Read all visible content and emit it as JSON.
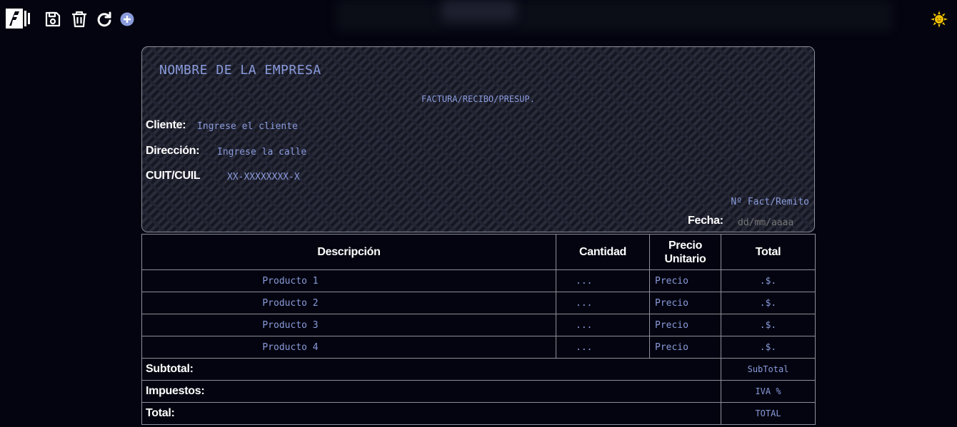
{
  "toolbar": {
    "icons": [
      "brand-logo-icon",
      "save-icon",
      "trash-icon",
      "refresh-icon",
      "add-icon",
      "theme-toggle-sun-icon"
    ],
    "accent": "#8a9bdc",
    "sun_color": "#f2c200"
  },
  "header": {
    "company_name": "NOMBRE DE LA EMPRESA",
    "doc_type": "FACTURA/RECIBO/PRESUP.",
    "client_label": "Cliente:",
    "client_value": "Ingrese el cliente",
    "address_label": "Dirección:",
    "address_value": "Ingrese la calle",
    "cuit_label": "CUIT/CUIL",
    "cuit_value": "XX-XXXXXXXX-X",
    "invoice_number": "Nº Fact/Remito",
    "date_label": "Fecha:",
    "date_placeholder": "dd/mm/aaaa"
  },
  "table": {
    "columns": [
      "Descripción",
      "Cantidad",
      "Precio Unitario",
      "Total"
    ],
    "rows": [
      {
        "description": "Producto 1",
        "quantity": "...",
        "unit_price": "Precio",
        "total": ".$."
      },
      {
        "description": "Producto 2",
        "quantity": "...",
        "unit_price": "Precio",
        "total": ".$."
      },
      {
        "description": "Producto 3",
        "quantity": "...",
        "unit_price": "Precio",
        "total": ".$."
      },
      {
        "description": "Producto 4",
        "quantity": "...",
        "unit_price": "Precio",
        "total": ".$."
      }
    ],
    "summary": [
      {
        "label": "Subtotal:",
        "value": "SubTotal"
      },
      {
        "label": "Impuestos:",
        "value": "IVA %"
      },
      {
        "label": "Total:",
        "value": "TOTAL"
      }
    ]
  }
}
